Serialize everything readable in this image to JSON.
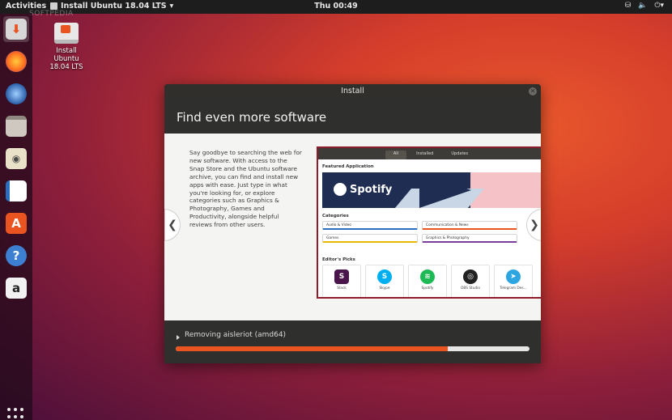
{
  "topbar": {
    "activities": "Activities",
    "app_menu": "Install Ubuntu 18.04 LTS",
    "clock": "Thu 00:49",
    "tray_icons": [
      "network-icon",
      "volume-icon",
      "power-icon"
    ]
  },
  "watermark": "SOFTPEDIA",
  "desktop_icon": {
    "label": "Install Ubuntu 18.04 LTS"
  },
  "dock": {
    "items": [
      "install-ubuntu",
      "firefox",
      "thunderbird",
      "files",
      "rhythmbox",
      "libreoffice-writer",
      "ubuntu-software",
      "help",
      "amazon"
    ]
  },
  "window": {
    "title": "Install",
    "heading": "Find even more software",
    "description": "Say goodbye to searching the web for new software. With access to the Snap Store and the Ubuntu software archive, you can find and install new apps with ease. Just type in what you're looking for, or explore categories such as Graphics & Photography, Games and Productivity, alongside helpful reviews from other users.",
    "store": {
      "tabs": [
        "All",
        "Installed",
        "Updates"
      ],
      "featured_label": "Featured Application",
      "featured_name": "Spotify",
      "categories_label": "Categories",
      "categories": [
        "Audio & Video",
        "Communication & News",
        "Games",
        "Graphics & Photography"
      ],
      "editors_label": "Editor's Picks",
      "picks": [
        "Slack",
        "Skype",
        "Spotify",
        "OBS Studio",
        "Telegram Des..."
      ]
    },
    "status": "Removing aisleriot (amd64)",
    "progress_percent": 77
  },
  "colors": {
    "accent": "#e95420",
    "panel": "#1d1d1d",
    "window": "#2f2f2d"
  }
}
